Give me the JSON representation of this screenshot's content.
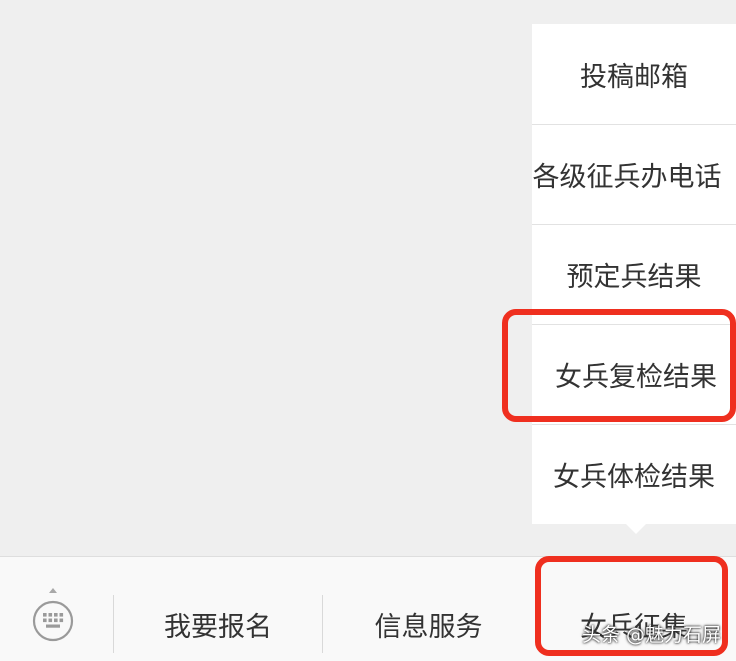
{
  "submenu": {
    "items": [
      {
        "label": "投稿邮箱"
      },
      {
        "label": "各级征兵办电话"
      },
      {
        "label": "预定兵结果"
      },
      {
        "label": "女兵复检结果"
      },
      {
        "label": "女兵体检结果"
      }
    ]
  },
  "menu_bar": {
    "keyboard_icon": "keyboard-icon",
    "tabs": [
      {
        "label": "我要报名"
      },
      {
        "label": "信息服务"
      },
      {
        "label": "女兵征集"
      }
    ]
  },
  "annotations": {
    "highlight_color": "#ef2f1f"
  },
  "watermark": {
    "text": "头条 @魅力石屏"
  }
}
